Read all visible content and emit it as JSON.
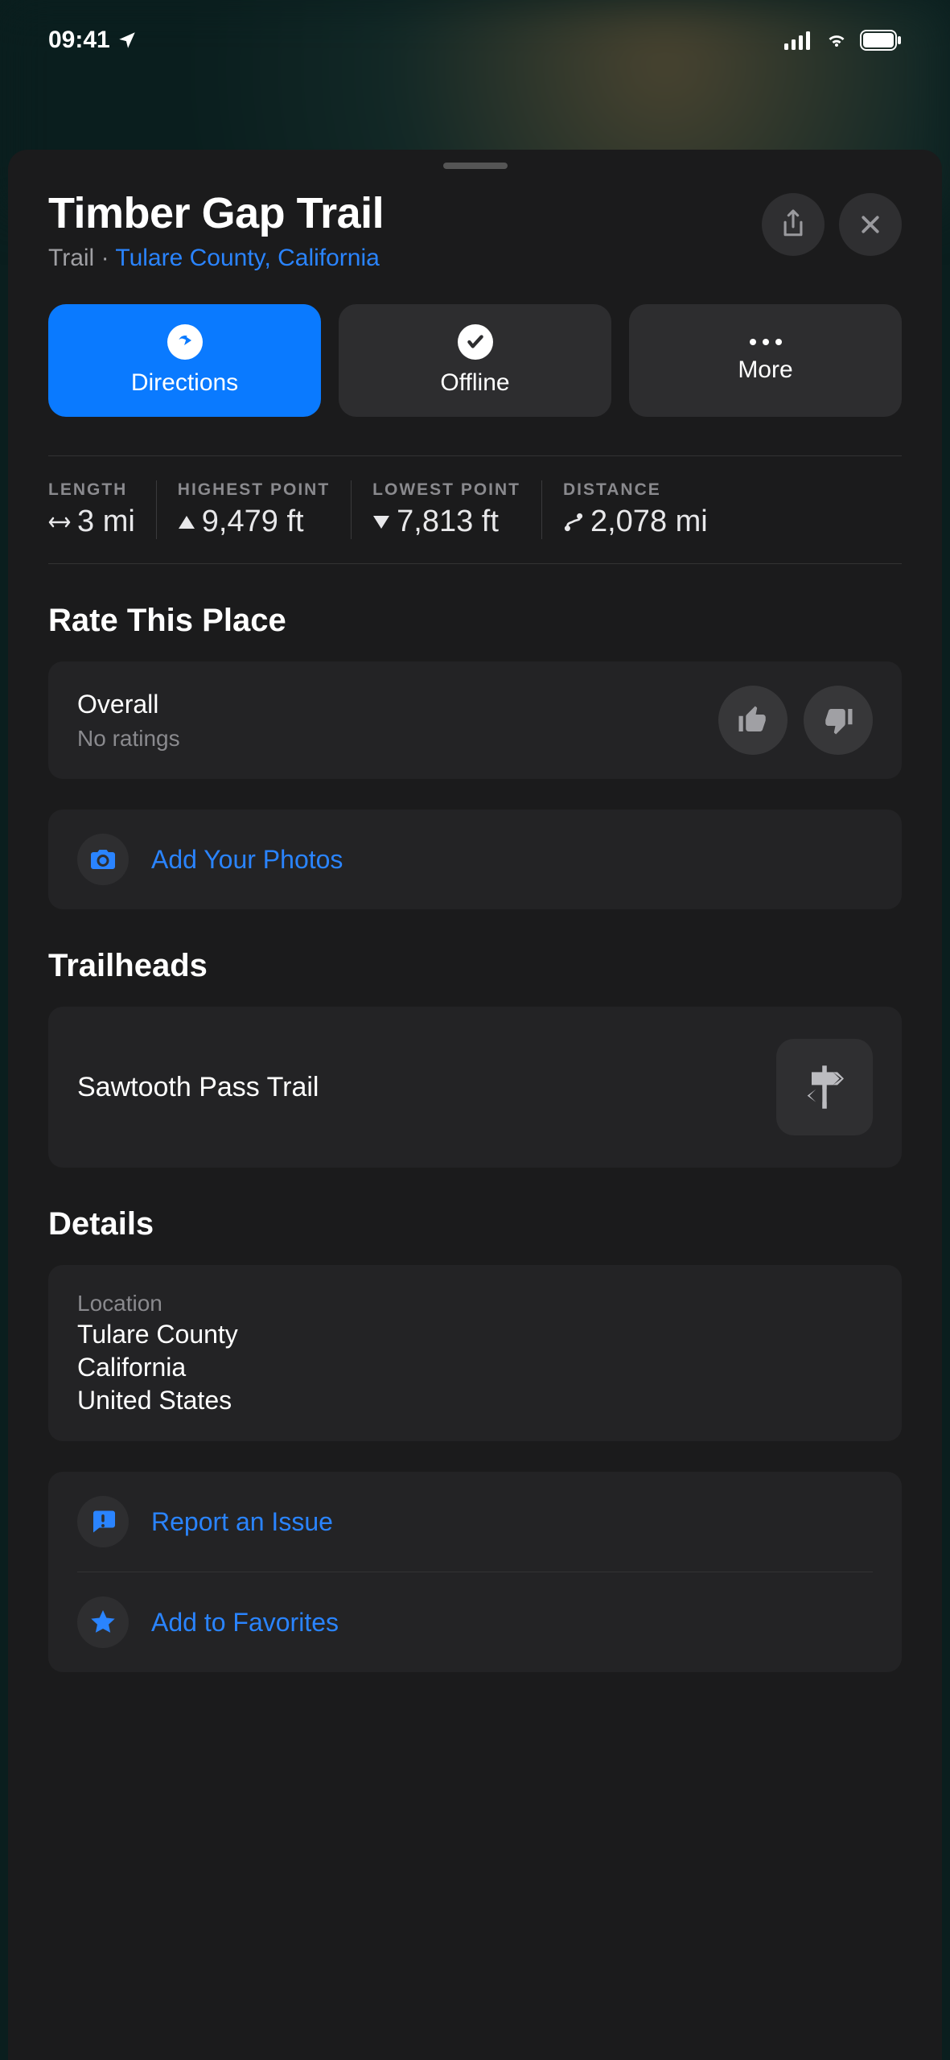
{
  "status": {
    "time": "09:41"
  },
  "place": {
    "title": "Timber Gap Trail",
    "category": "Trail",
    "location_link": "Tulare County, California"
  },
  "actions": {
    "directions": "Directions",
    "offline": "Offline",
    "more": "More"
  },
  "stats": {
    "length": {
      "label": "LENGTH",
      "value": "3 mi"
    },
    "highest_point": {
      "label": "HIGHEST POINT",
      "value": "9,479 ft"
    },
    "lowest_point": {
      "label": "LOWEST POINT",
      "value": "7,813 ft"
    },
    "distance": {
      "label": "DISTANCE",
      "value": "2,078 mi"
    }
  },
  "rate": {
    "section_title": "Rate This Place",
    "overall_label": "Overall",
    "no_ratings": "No ratings",
    "add_photos": "Add Your Photos"
  },
  "trailheads": {
    "section_title": "Trailheads",
    "items": [
      {
        "name": "Sawtooth Pass Trail"
      }
    ]
  },
  "details": {
    "section_title": "Details",
    "location_label": "Location",
    "location_lines": [
      "Tulare County",
      "California",
      "United States"
    ],
    "report_issue": "Report an Issue",
    "add_favorites": "Add to Favorites"
  }
}
